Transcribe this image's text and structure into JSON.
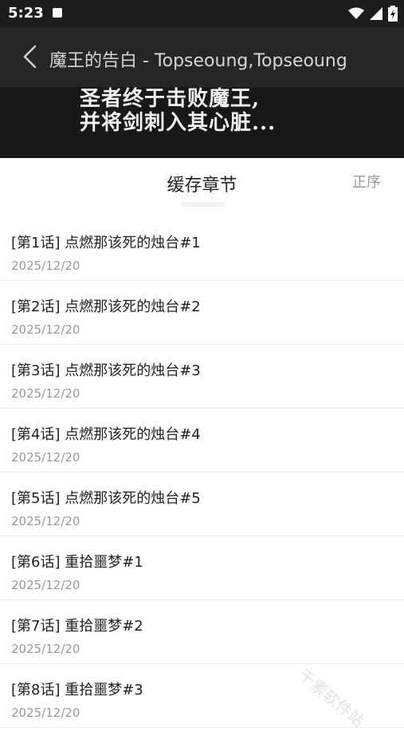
{
  "status_bar": {
    "time": "5:23",
    "app_icon": "A"
  },
  "header": {
    "title": "魔王的告白 - Topseoung,Topseoung",
    "back_icon": "chevron-left-icon"
  },
  "banner": {
    "line1": "圣者终于击败魔王,",
    "line2": "并将剑刺入其心脏..."
  },
  "sheet": {
    "title": "缓存章节",
    "sort_label": "正序"
  },
  "chapters": [
    {
      "title": "[第1话] 点燃那该死的烛台#1",
      "date": "2025/12/20"
    },
    {
      "title": "[第2话] 点燃那该死的烛台#2",
      "date": "2025/12/20"
    },
    {
      "title": "[第3话] 点燃那该死的烛台#3",
      "date": "2025/12/20"
    },
    {
      "title": "[第4话] 点燃那该死的烛台#4",
      "date": "2025/12/20"
    },
    {
      "title": "[第5话] 点燃那该死的烛台#5",
      "date": "2025/12/20"
    },
    {
      "title": "[第6话] 重拾噩梦#1",
      "date": "2025/12/20"
    },
    {
      "title": "[第7话] 重拾噩梦#2",
      "date": "2025/12/20"
    },
    {
      "title": "[第8话] 重拾噩梦#3",
      "date": "2025/12/20"
    }
  ],
  "watermark": "千素软件站"
}
